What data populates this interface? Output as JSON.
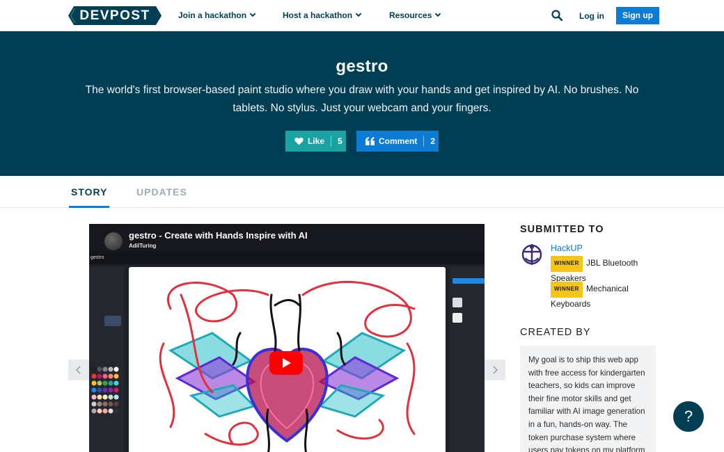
{
  "nav": {
    "logo": "DEVPOST",
    "items": [
      {
        "label": "Join a hackathon"
      },
      {
        "label": "Host a hackathon"
      },
      {
        "label": "Resources"
      }
    ],
    "login": "Log in",
    "signup": "Sign up"
  },
  "hero": {
    "title": "gestro",
    "tagline": "The world's first browser-based paint studio where you draw with your hands and get inspired by AI. No brushes. No tablets. No stylus. Just your webcam and your fingers.",
    "like_label": "Like",
    "like_count": "5",
    "comment_label": "Comment",
    "comment_count": "2"
  },
  "tabs": [
    {
      "label": "STORY",
      "active": true
    },
    {
      "label": "UPDATES",
      "active": false
    }
  ],
  "video": {
    "title": "gestro - Create with Hands Inspire with AI",
    "channel": "AdilTuring",
    "app_name": "gestro"
  },
  "sidebar": {
    "submitted_heading": "SUBMITTED TO",
    "hackathon": "HackUP",
    "winner_badge": "WINNER",
    "prizes": [
      "JBL Bluetooth Speakers",
      "Mechanical Keyboards"
    ],
    "created_heading": "CREATED BY",
    "creator_text": "My goal is to ship this web app with free access for kindergarten teachers, so kids can improve their fine motor skills and get familiar with AI image generation in a fun, hands-on way. The token purchase system where users pay tokens on my platform to"
  },
  "colors": {
    "brand": "#003e54",
    "accent_blue": "#0b7bd3",
    "teal": "#1ba3a3",
    "winner": "#f5c518"
  },
  "icons": [
    "search-icon",
    "heart-icon",
    "quote-icon",
    "chevron-down-icon",
    "play-icon",
    "chevron-left-icon",
    "chevron-right-icon",
    "help-icon"
  ]
}
